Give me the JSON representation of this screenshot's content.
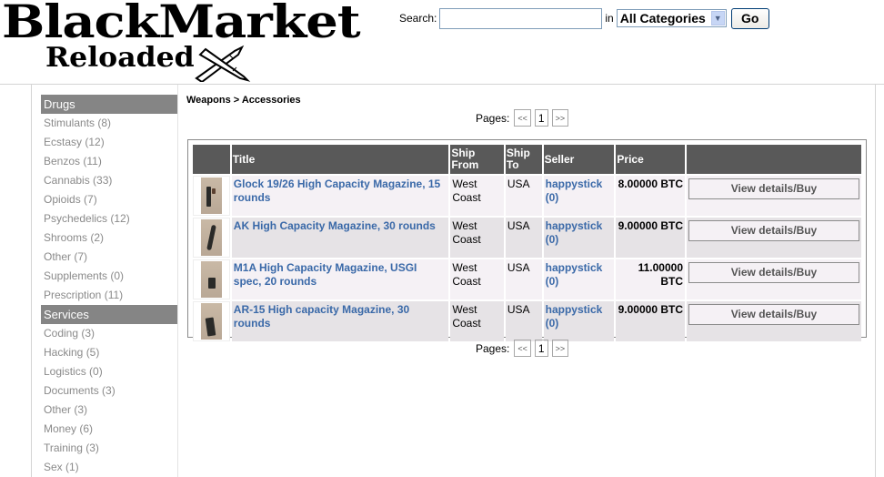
{
  "header": {
    "logo_line1": "BlackMarket",
    "logo_line2": "Reloaded",
    "search_label": "Search:",
    "search_value": "",
    "in_label": "in",
    "category_selected": "All Categories",
    "go_label": "Go"
  },
  "sidebar": {
    "sections": [
      {
        "title": "Drugs",
        "items": [
          "Stimulants (8)",
          "Ecstasy (12)",
          "Benzos (11)",
          "Cannabis (33)",
          "Opioids (7)",
          "Psychedelics (12)",
          "Shrooms (2)",
          "Other (7)",
          "Supplements (0)",
          "Prescription (11)"
        ]
      },
      {
        "title": "Services",
        "items": [
          "Coding (3)",
          "Hacking (5)",
          "Logistics (0)",
          "Documents (3)",
          "Other (3)",
          "Money (6)",
          "Training (3)",
          "Sex (1)"
        ]
      }
    ]
  },
  "main": {
    "breadcrumb": "Weapons > Accessories",
    "pager": {
      "label": "Pages:",
      "prev": "<<",
      "current": "1",
      "next": ">>"
    },
    "table": {
      "headers": [
        "",
        "Title",
        "Ship From",
        "Ship To",
        "Seller",
        "Price",
        ""
      ],
      "rows": [
        {
          "title": "Glock 19/26 High Capacity Magazine, 15 rounds",
          "ship_from": "West Coast",
          "ship_to": "USA",
          "seller": "happystick (0)",
          "price": "8.00000 BTC",
          "action": "View details/Buy"
        },
        {
          "title": "AK High Capacity Magazine, 30 rounds",
          "ship_from": "West Coast",
          "ship_to": "USA",
          "seller": "happystick (0)",
          "price": "9.00000 BTC",
          "action": "View details/Buy"
        },
        {
          "title": "M1A High Capacity Magazine, USGI spec, 20 rounds",
          "ship_from": "West Coast",
          "ship_to": "USA",
          "seller": "happystick (0)",
          "price": "11.00000 BTC",
          "action": "View details/Buy"
        },
        {
          "title": "AR-15 High capacity Magazine, 30 rounds",
          "ship_from": "West Coast",
          "ship_to": "USA",
          "seller": "happystick (0)",
          "price": "9.00000 BTC",
          "action": "View details/Buy"
        }
      ]
    }
  },
  "colors": {
    "category_header_bg": "#858585",
    "table_header_bg": "#595959",
    "link": "#3a69a8",
    "row_odd": "#f5f1f5",
    "row_even": "#e6e3e6"
  }
}
